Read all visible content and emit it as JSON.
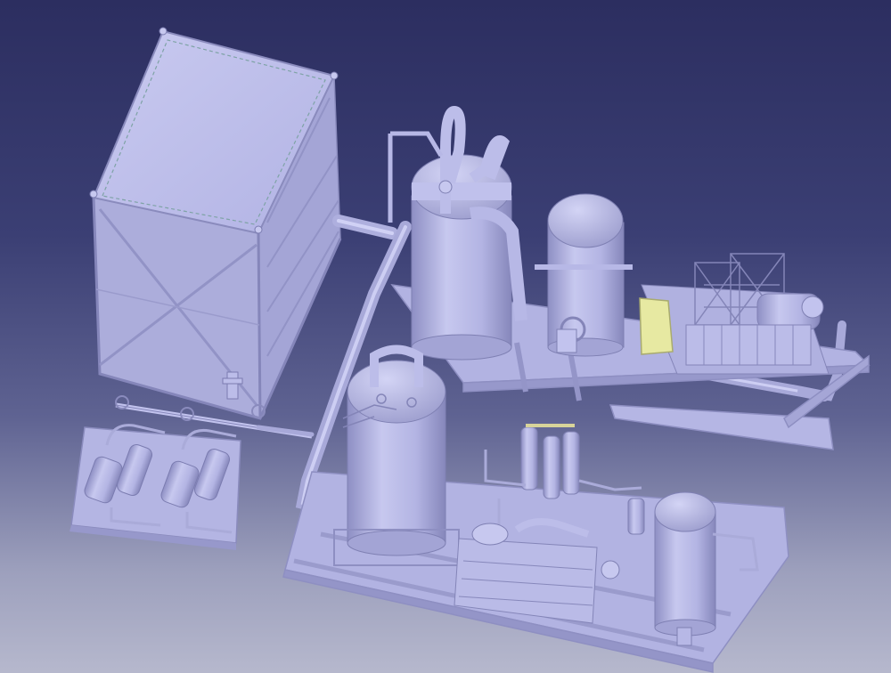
{
  "viewport": {
    "background_top": "#2c2e60",
    "background_bottom": "#b6b8cd",
    "part_color": "#bcbde9",
    "part_shade": "#9a9bcc",
    "highlight_color": "#e7e9a2"
  },
  "model": {
    "components": [
      "water-tank",
      "heat-exchanger-skid",
      "tall-vessel-with-bent-pipes",
      "receiver-tank-upper",
      "compressor-skid-upper",
      "pressure-vessel-lower",
      "filter-dryer-assembly",
      "compressor-unit-lower",
      "receiver-tank-lower",
      "main-pipe-run"
    ]
  }
}
